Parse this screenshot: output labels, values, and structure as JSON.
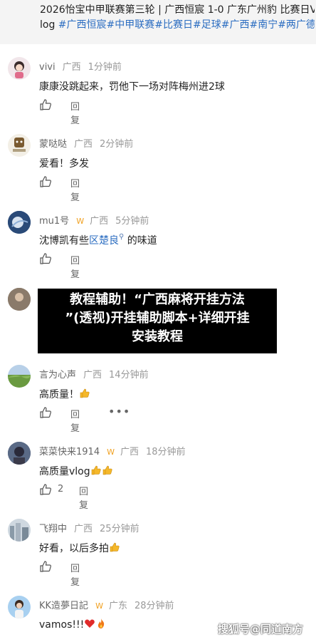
{
  "post": {
    "line1": "2026怡宝中甲联赛第三轮 | 广西恒宸 1-0 广东广州豹 比赛日V",
    "line2_prefix": "log ",
    "tags": [
      "#广西恒宸",
      "#中甲联赛",
      "#比赛日",
      "#足球",
      "#广西",
      "#南宁",
      "#两广德比"
    ]
  },
  "comments": [
    {
      "username": "vivi",
      "region": "广西",
      "time": "1分钟前",
      "text": "康康没跳起来，罚他下一场对阵梅州进2球",
      "reply": "回复"
    },
    {
      "username": "蒙哒哒",
      "region": "广西",
      "time": "2分钟前",
      "text": "爱看！多发",
      "reply": "回复"
    },
    {
      "username": "mu1号",
      "region": "广西",
      "time": "5分钟前",
      "text_prefix": "沈博凯有些",
      "text_link": "区楚良",
      "text_suffix": " 的味道",
      "reply": "回复"
    },
    {
      "username": "",
      "region": "",
      "time": "",
      "text": "",
      "reply": ""
    },
    {
      "username": "言为心声",
      "region": "广西",
      "time": "14分钟前",
      "text": "高质量！",
      "reply": "回复"
    },
    {
      "username": "菜菜快来1914",
      "region": "广西",
      "time": "18分钟前",
      "text": "高质量vlog",
      "like_count": "2",
      "reply": "回复"
    },
    {
      "username": "飞翔中",
      "region": "广西",
      "time": "25分钟前",
      "text": "好看，以后多拍",
      "reply": "回复"
    },
    {
      "username": "KK造夢日記",
      "region": "广东",
      "time": "28分钟前",
      "text": "vamos!!!"
    }
  ],
  "overlay": {
    "line1": "教程辅助！“广西麻将开挂方法",
    "line2": "”(透视)开挂辅助脚本+详细开挂",
    "line3": "安装教程"
  },
  "watermark": "搜狐号@同道南方",
  "icons": {
    "like": "thumbs-up-icon",
    "more": "more-dots-icon",
    "search": "search-icon",
    "verified": "verified-badge-icon",
    "thumbs_emoji": "thumbs-up-emoji",
    "heart_emoji": "heart-emoji",
    "fire_emoji": "fire-emoji"
  },
  "colors": {
    "tag": "#2b6dc1",
    "meta": "#999999",
    "verified": "#f0a020",
    "overlay_bg": "#000000"
  }
}
